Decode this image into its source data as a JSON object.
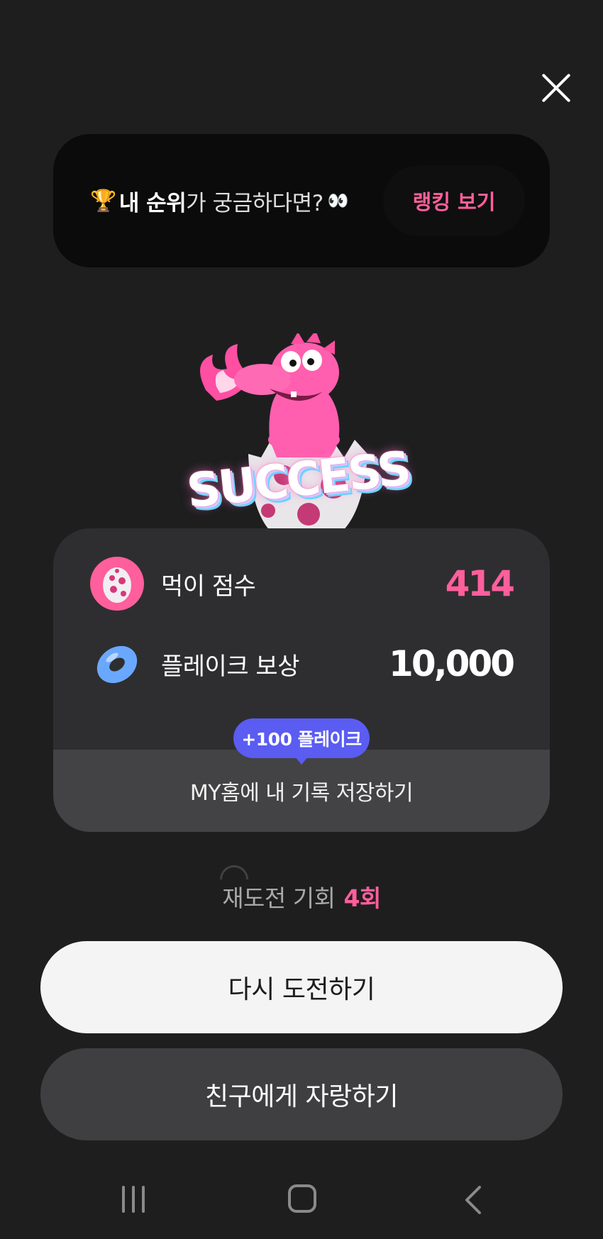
{
  "rank_banner": {
    "prefix_strong": "내 순위",
    "suffix": "가 궁금하다면?",
    "trophy_icon": "🏆",
    "eyes_icon": "👀",
    "button_label": "랭킹 보기"
  },
  "mascot": {
    "success_text": "SUCCESS"
  },
  "result": {
    "score_label": "먹이 점수",
    "score_value": "414",
    "flake_label": "플레이크 보상",
    "flake_value": "10,000",
    "bonus_badge": "+100 플레이크",
    "save_label": "MY홈에 내 기록 저장하기"
  },
  "retry": {
    "label": "재도전 기회",
    "count": "4회"
  },
  "buttons": {
    "retry": "다시 도전하기",
    "share": "친구에게 자랑하기"
  },
  "colors": {
    "accent_pink": "#ff5f9c",
    "badge_purple": "#5a5cf2",
    "background": "#1e1e1f"
  }
}
